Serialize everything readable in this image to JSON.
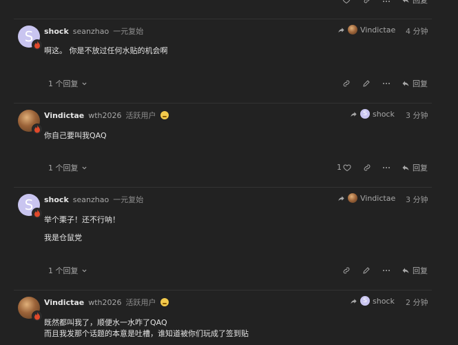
{
  "top": {
    "reply_label": "回复"
  },
  "posts": [
    {
      "username": "shock",
      "fullname": "seanzhao",
      "title": "一元复始",
      "reply_to": "Vindictae",
      "time": "4 分钟",
      "lines": [
        "啊这。 你是不放过任何水贴的机会啊"
      ],
      "replies": "1 个回复",
      "reply_label": "回复",
      "avatar_letter": "S"
    },
    {
      "username": "Vindictae",
      "fullname": "wth2026",
      "title": "活跃用户",
      "reply_to": "shock",
      "time": "3 分钟",
      "lines": [
        "你自己要叫我QAQ"
      ],
      "replies": "1 个回复",
      "likes": "1",
      "reply_label": "回复"
    },
    {
      "username": "shock",
      "fullname": "seanzhao",
      "title": "一元复始",
      "reply_to": "Vindictae",
      "time": "3 分钟",
      "lines": [
        "举个栗子！还不行呐！",
        "我是仓鼠党"
      ],
      "replies": "1 个回复",
      "reply_label": "回复",
      "avatar_letter": "S"
    },
    {
      "username": "Vindictae",
      "fullname": "wth2026",
      "title": "活跃用户",
      "reply_to": "shock",
      "time": "2 分钟",
      "lines": [
        "既然都叫我了，顺便水一水咋了QAQ",
        "而且我发那个话题的本意是吐槽，谁知道被你们玩成了签到贴"
      ]
    }
  ],
  "colors": {
    "background": "#222222",
    "accent_avatar": "#c9c5f0",
    "flair": "#e0492b"
  }
}
